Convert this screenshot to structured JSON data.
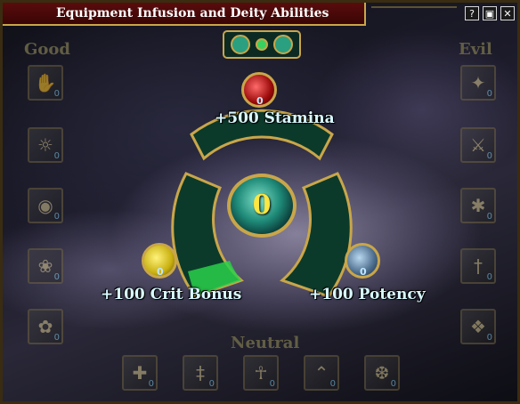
{
  "window": {
    "title": "Equipment Infusion and Deity Abilities",
    "controls": [
      "?",
      "▣",
      "✕"
    ]
  },
  "columns": {
    "good": "Good",
    "evil": "Evil",
    "neutral": "Neutral"
  },
  "center": {
    "value": "0"
  },
  "abilities": {
    "top": {
      "count": "0",
      "label": "+500 Stamina",
      "color": "#c81e1e"
    },
    "left": {
      "count": "0",
      "label": "+100 Crit Bonus",
      "color": "#d8c81e"
    },
    "right": {
      "count": "0",
      "label": "+100 Potency",
      "color": "#5a7a9a"
    }
  },
  "good_slots": [
    {
      "count": "0",
      "icon": "hand-icon"
    },
    {
      "count": "0",
      "icon": "sun-icon"
    },
    {
      "count": "0",
      "icon": "eye-icon"
    },
    {
      "count": "0",
      "icon": "leaf-icon"
    },
    {
      "count": "0",
      "icon": "flower-icon"
    }
  ],
  "evil_slots": [
    {
      "count": "0",
      "icon": "feather-icon"
    },
    {
      "count": "0",
      "icon": "blade-icon"
    },
    {
      "count": "0",
      "icon": "claw-icon"
    },
    {
      "count": "0",
      "icon": "dagger-icon"
    },
    {
      "count": "0",
      "icon": "rune-icon"
    }
  ],
  "neutral_slots": [
    {
      "count": "0",
      "icon": "cross-icon"
    },
    {
      "count": "0",
      "icon": "sword-icon"
    },
    {
      "count": "0",
      "icon": "ankh-icon"
    },
    {
      "count": "0",
      "icon": "wing-icon"
    },
    {
      "count": "0",
      "icon": "flame-icon"
    }
  ]
}
